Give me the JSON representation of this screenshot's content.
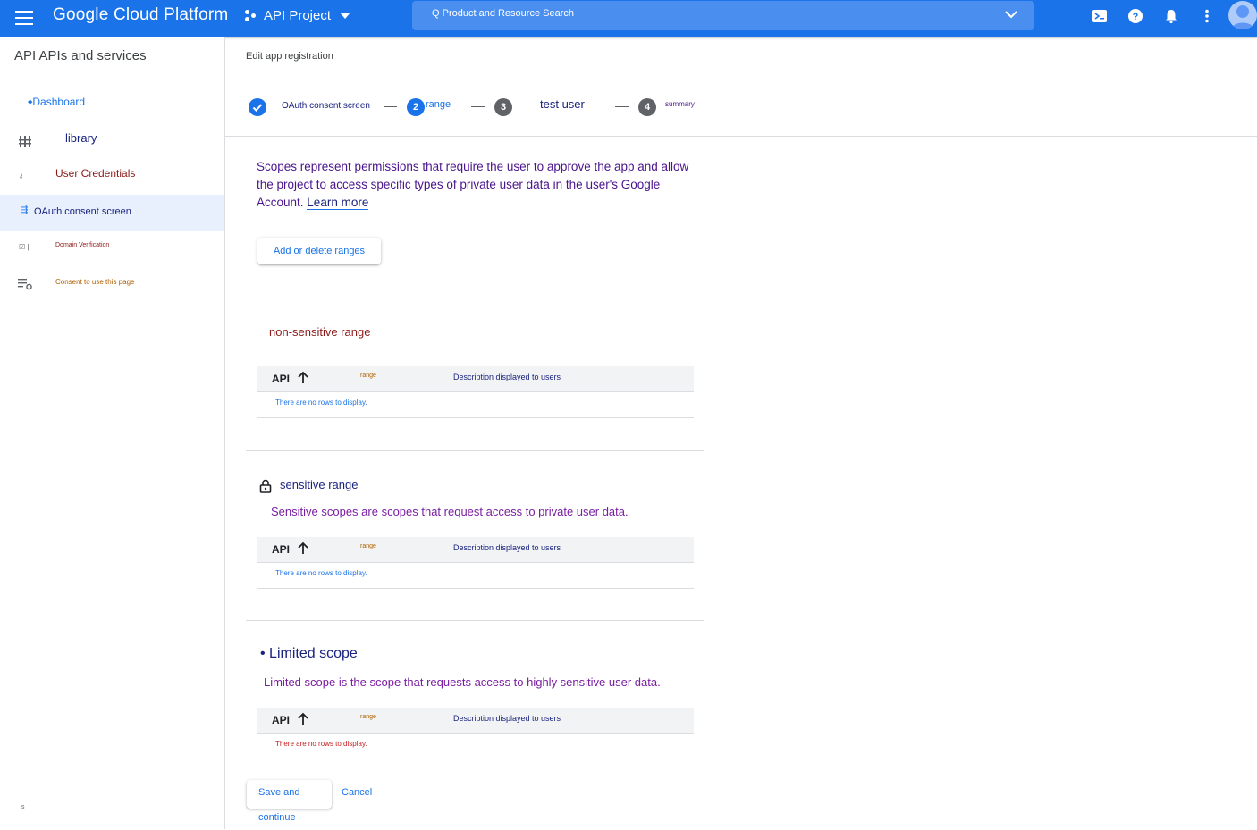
{
  "topbar": {
    "brand": "Google Cloud Platform",
    "project": "API Project",
    "search_text": "Q Product and Resource Search",
    "icons": [
      "menu-icon",
      "project-dots-icon",
      "chevron-down-icon",
      "terminal-icon",
      "help-icon",
      "bell-icon",
      "more-vert-icon",
      "account-icon"
    ],
    "color": "#1a73e8"
  },
  "sidebar": {
    "title": "API APIs and services",
    "items": [
      {
        "label": "Dashboard",
        "icon": "diamond-icon",
        "color": "#1a73e8"
      },
      {
        "label": "library",
        "icon": "library-icon",
        "color": "#1a237e"
      },
      {
        "label": "User Credentials",
        "icon": "key-icon",
        "color": "#8b1a1a"
      },
      {
        "label": "OAuth consent screen",
        "icon": "consent-icon",
        "color": "#1a237e",
        "active": true
      },
      {
        "label": "Domain Verification",
        "icon": "checkbox-icon",
        "color": "#8b1a1a"
      },
      {
        "label": "Consent to use this page",
        "icon": "settings-list-icon",
        "color": "#b06000"
      }
    ],
    "footer": "s"
  },
  "main": {
    "title": "Edit app registration"
  },
  "stepper": {
    "steps": [
      {
        "number": "",
        "label": "OAuth consent screen",
        "state": "done"
      },
      {
        "number": "2",
        "label": "range",
        "state": "active"
      },
      {
        "number": "3",
        "label": "test user",
        "state": "pending"
      },
      {
        "number": "4",
        "label": "summary",
        "state": "pending"
      }
    ]
  },
  "content": {
    "intro": "Scopes represent permissions that require the user to approve the app and allow the project to access specific types of private user data in the user's Google Account.",
    "learn_more": "Learn more",
    "add_button": "Add or delete ranges",
    "sections": [
      {
        "title": "non-sensitive range",
        "description": ""
      },
      {
        "title": "sensitive range",
        "description": "Sensitive scopes are scopes that request access to private user data."
      },
      {
        "title": "• Limited scope",
        "description": "Limited scope is the scope that requests access to highly sensitive user data."
      }
    ],
    "table": {
      "col_api": "API",
      "col_range": "range",
      "col_desc": "Description displayed to users",
      "empty": "There are no rows to display."
    },
    "save_button": "Save and continue",
    "cancel_button": "Cancel"
  }
}
